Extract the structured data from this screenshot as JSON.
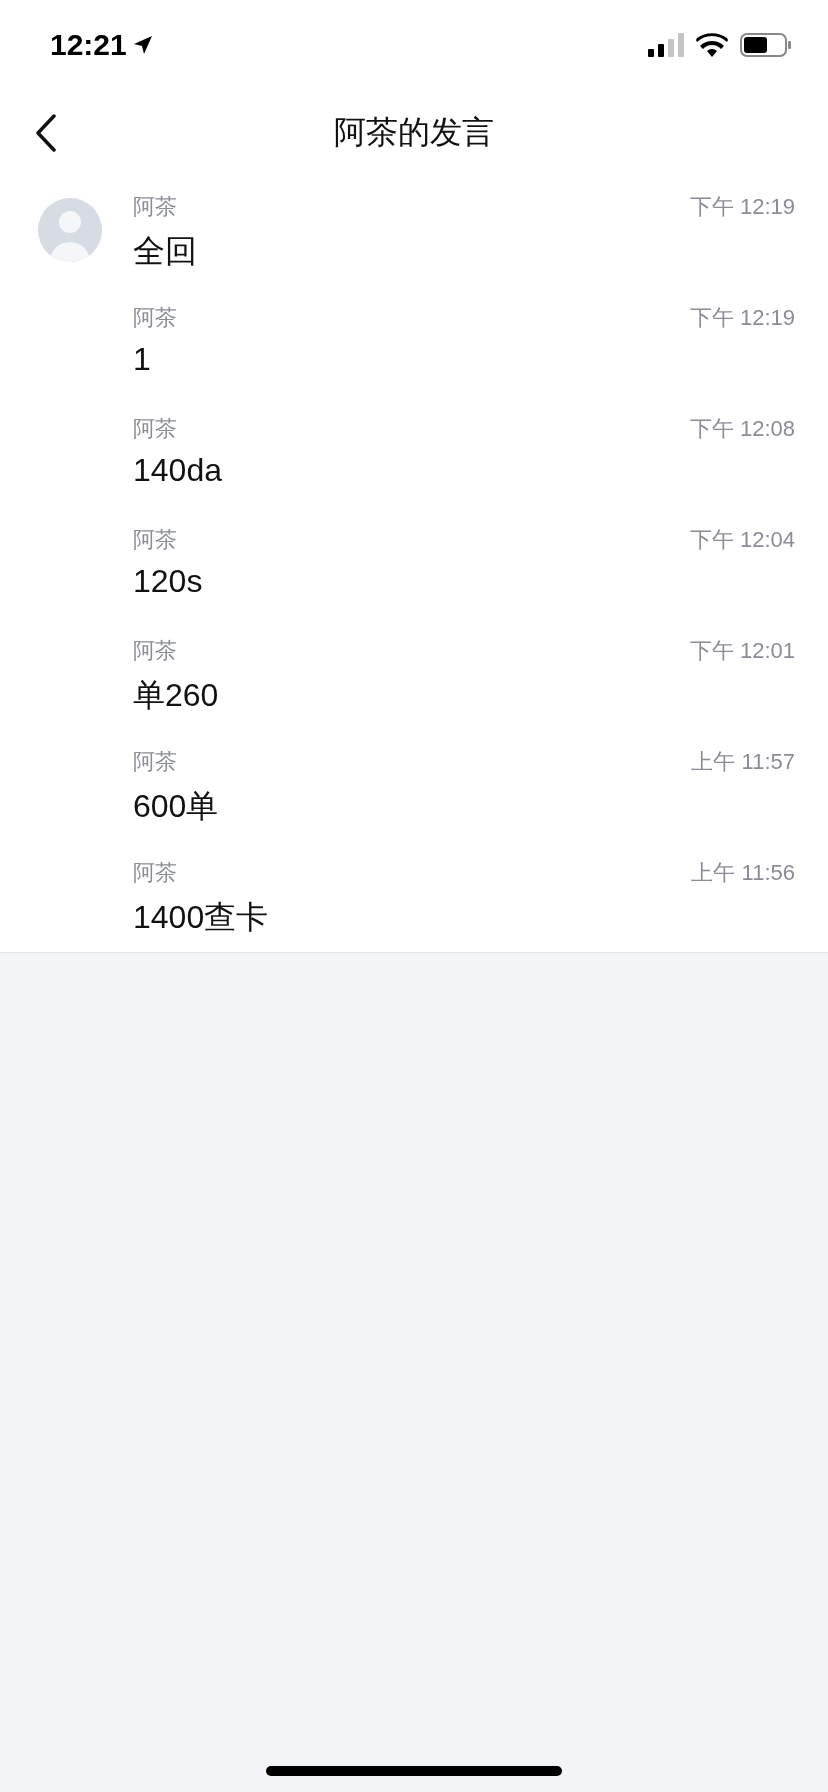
{
  "status_bar": {
    "time": "12:21"
  },
  "nav": {
    "title": "阿茶的发言"
  },
  "messages": [
    {
      "sender": "阿茶",
      "time": "下午 12:19",
      "text": "全回",
      "show_avatar": true
    },
    {
      "sender": "阿茶",
      "time": "下午 12:19",
      "text": "1",
      "show_avatar": false
    },
    {
      "sender": "阿茶",
      "time": "下午 12:08",
      "text": "140da",
      "show_avatar": false
    },
    {
      "sender": "阿茶",
      "time": "下午 12:04",
      "text": "120s",
      "show_avatar": false
    },
    {
      "sender": "阿茶",
      "time": "下午 12:01",
      "text": "单260",
      "show_avatar": false
    },
    {
      "sender": "阿茶",
      "time": "上午 11:57",
      "text": "600单",
      "show_avatar": false
    },
    {
      "sender": "阿茶",
      "time": "上午 11:56",
      "text": "1400查卡",
      "show_avatar": false
    }
  ]
}
